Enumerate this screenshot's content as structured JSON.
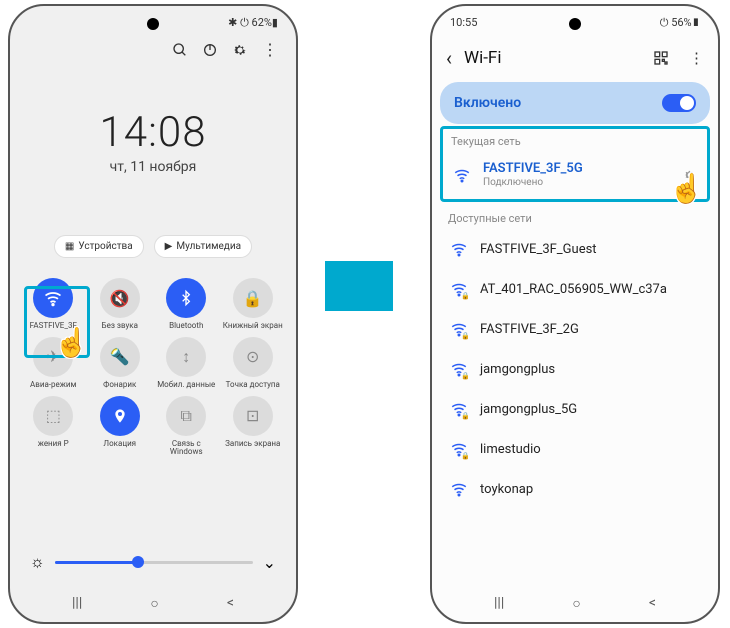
{
  "arrow_color": "#00a9ce",
  "phone1": {
    "status_right": "✱ ⏻ 62%▮",
    "icons": {
      "search": "search-icon",
      "power": "power-icon",
      "gear": "gear-icon",
      "more": "more-icon"
    },
    "time": "14:08",
    "date": "чт, 11 ноября",
    "chip_devices": "Устройства",
    "chip_media": "Мультимедиа",
    "tiles": [
      {
        "label": "FASTFIVE_3F",
        "on": true,
        "icon": "📶"
      },
      {
        "label": "Без звука",
        "on": false,
        "icon": "🔇"
      },
      {
        "label": "Bluetooth",
        "on": true,
        "icon": "ᚼ"
      },
      {
        "label": "Книжный экран",
        "on": false,
        "icon": "🔒"
      },
      {
        "label": "Авиа-режим",
        "on": false,
        "icon": "✈"
      },
      {
        "label": "Фонарик",
        "on": false,
        "icon": "🔦"
      },
      {
        "label": "Мобил. данные",
        "on": false,
        "icon": "↕"
      },
      {
        "label": "Точка доступа",
        "on": false,
        "icon": "⊙"
      },
      {
        "label": "жения     Р",
        "on": false,
        "icon": "⬚"
      },
      {
        "label": "Локация",
        "on": true,
        "icon": "◉"
      },
      {
        "label": "Связь с Windows",
        "on": false,
        "icon": "⧉"
      },
      {
        "label": "Запись экрана",
        "on": false,
        "icon": "⊡"
      }
    ],
    "brightness_pct": 42
  },
  "phone2": {
    "status_left": "10:55",
    "status_right": "⏻ 56%▮",
    "back": "‹",
    "title": "Wi-Fi",
    "toggle_label": "Включено",
    "section_current": "Текущая сеть",
    "current": {
      "name": "FASTFIVE_3F_5G",
      "sub": "Подключено"
    },
    "section_available": "Доступные сети",
    "networks": [
      {
        "name": "FASTFIVE_3F_Guest",
        "lock": false
      },
      {
        "name": "AT_401_RAC_056905_WW_c37a",
        "lock": true
      },
      {
        "name": "FASTFIVE_3F_2G",
        "lock": true
      },
      {
        "name": "jamgongplus",
        "lock": true
      },
      {
        "name": "jamgongplus_5G",
        "lock": true
      },
      {
        "name": "limestudio",
        "lock": true
      },
      {
        "name": "toykonap",
        "lock": false
      }
    ]
  }
}
